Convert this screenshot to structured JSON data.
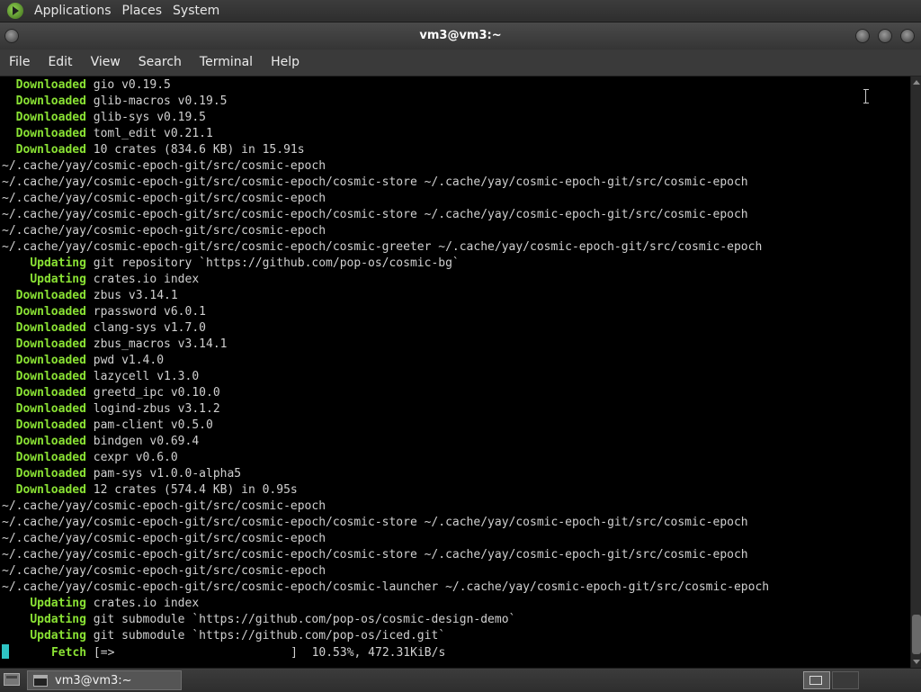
{
  "top_panel": {
    "logo_icon": "distro-logo-icon",
    "menus": [
      "Applications",
      "Places",
      "System"
    ]
  },
  "window": {
    "title": "vm3@vm3:~",
    "menubar": [
      "File",
      "Edit",
      "View",
      "Search",
      "Terminal",
      "Help"
    ]
  },
  "terminal": {
    "colors": {
      "background": "#000000",
      "text": "#d0d0d0",
      "keyword": "#8ae234",
      "cursor": "#2ec4c4"
    },
    "lines": [
      {
        "indent": "  ",
        "kw": "Downloaded",
        "text": " gio v0.19.5"
      },
      {
        "indent": "  ",
        "kw": "Downloaded",
        "text": " glib-macros v0.19.5"
      },
      {
        "indent": "  ",
        "kw": "Downloaded",
        "text": " glib-sys v0.19.5"
      },
      {
        "indent": "  ",
        "kw": "Downloaded",
        "text": " toml_edit v0.21.1"
      },
      {
        "indent": "  ",
        "kw": "Downloaded",
        "text": " 10 crates (834.6 KB) in 15.91s"
      },
      {
        "indent": "",
        "kw": "",
        "text": "~/.cache/yay/cosmic-epoch-git/src/cosmic-epoch"
      },
      {
        "indent": "",
        "kw": "",
        "text": "~/.cache/yay/cosmic-epoch-git/src/cosmic-epoch/cosmic-store ~/.cache/yay/cosmic-epoch-git/src/cosmic-epoch"
      },
      {
        "indent": "",
        "kw": "",
        "text": "~/.cache/yay/cosmic-epoch-git/src/cosmic-epoch"
      },
      {
        "indent": "",
        "kw": "",
        "text": "~/.cache/yay/cosmic-epoch-git/src/cosmic-epoch/cosmic-store ~/.cache/yay/cosmic-epoch-git/src/cosmic-epoch"
      },
      {
        "indent": "",
        "kw": "",
        "text": "~/.cache/yay/cosmic-epoch-git/src/cosmic-epoch"
      },
      {
        "indent": "",
        "kw": "",
        "text": "~/.cache/yay/cosmic-epoch-git/src/cosmic-epoch/cosmic-greeter ~/.cache/yay/cosmic-epoch-git/src/cosmic-epoch"
      },
      {
        "indent": "    ",
        "kw": "Updating",
        "text": " git repository `https://github.com/pop-os/cosmic-bg`"
      },
      {
        "indent": "    ",
        "kw": "Updating",
        "text": " crates.io index"
      },
      {
        "indent": "  ",
        "kw": "Downloaded",
        "text": " zbus v3.14.1"
      },
      {
        "indent": "  ",
        "kw": "Downloaded",
        "text": " rpassword v6.0.1"
      },
      {
        "indent": "  ",
        "kw": "Downloaded",
        "text": " clang-sys v1.7.0"
      },
      {
        "indent": "  ",
        "kw": "Downloaded",
        "text": " zbus_macros v3.14.1"
      },
      {
        "indent": "  ",
        "kw": "Downloaded",
        "text": " pwd v1.4.0"
      },
      {
        "indent": "  ",
        "kw": "Downloaded",
        "text": " lazycell v1.3.0"
      },
      {
        "indent": "  ",
        "kw": "Downloaded",
        "text": " greetd_ipc v0.10.0"
      },
      {
        "indent": "  ",
        "kw": "Downloaded",
        "text": " logind-zbus v3.1.2"
      },
      {
        "indent": "  ",
        "kw": "Downloaded",
        "text": " pam-client v0.5.0"
      },
      {
        "indent": "  ",
        "kw": "Downloaded",
        "text": " bindgen v0.69.4"
      },
      {
        "indent": "  ",
        "kw": "Downloaded",
        "text": " cexpr v0.6.0"
      },
      {
        "indent": "  ",
        "kw": "Downloaded",
        "text": " pam-sys v1.0.0-alpha5"
      },
      {
        "indent": "  ",
        "kw": "Downloaded",
        "text": " 12 crates (574.4 KB) in 0.95s"
      },
      {
        "indent": "",
        "kw": "",
        "text": "~/.cache/yay/cosmic-epoch-git/src/cosmic-epoch"
      },
      {
        "indent": "",
        "kw": "",
        "text": "~/.cache/yay/cosmic-epoch-git/src/cosmic-epoch/cosmic-store ~/.cache/yay/cosmic-epoch-git/src/cosmic-epoch"
      },
      {
        "indent": "",
        "kw": "",
        "text": "~/.cache/yay/cosmic-epoch-git/src/cosmic-epoch"
      },
      {
        "indent": "",
        "kw": "",
        "text": "~/.cache/yay/cosmic-epoch-git/src/cosmic-epoch/cosmic-store ~/.cache/yay/cosmic-epoch-git/src/cosmic-epoch"
      },
      {
        "indent": "",
        "kw": "",
        "text": "~/.cache/yay/cosmic-epoch-git/src/cosmic-epoch"
      },
      {
        "indent": "",
        "kw": "",
        "text": "~/.cache/yay/cosmic-epoch-git/src/cosmic-epoch/cosmic-launcher ~/.cache/yay/cosmic-epoch-git/src/cosmic-epoch"
      },
      {
        "indent": "    ",
        "kw": "Updating",
        "text": " crates.io index"
      },
      {
        "indent": "    ",
        "kw": "Updating",
        "text": " git submodule `https://github.com/pop-os/cosmic-design-demo`"
      },
      {
        "indent": "    ",
        "kw": "Updating",
        "text": " git submodule `https://github.com/pop-os/iced.git`"
      },
      {
        "indent": "       ",
        "kw": "Fetch",
        "text": " [=>                         ]  10.53%, 472.31KiB/s",
        "cursor": true
      }
    ]
  },
  "taskbar": {
    "show_desktop_icon": "show-desktop-icon",
    "task_label": "vm3@vm3:~",
    "task_icon": "terminal-icon",
    "workspace_icon": "workspace-switcher-icon"
  }
}
